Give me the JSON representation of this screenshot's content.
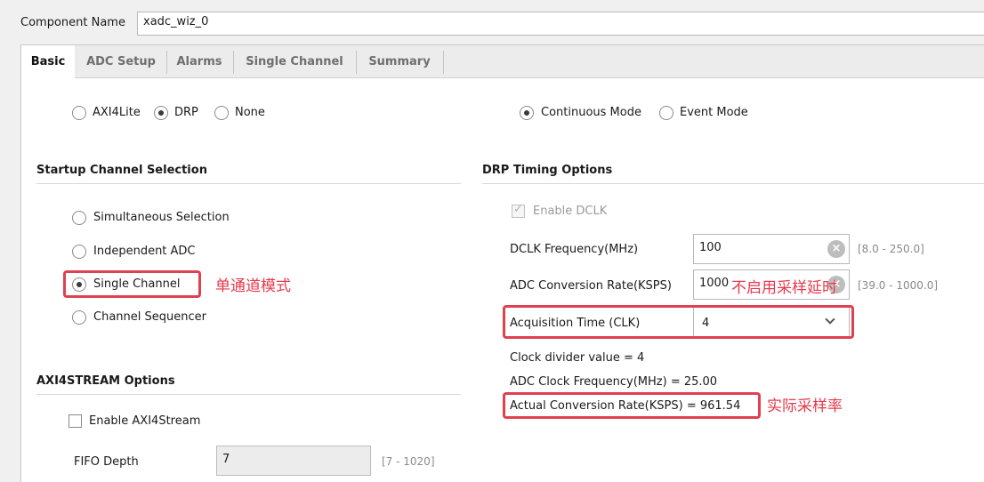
{
  "component": {
    "label": "Component Name",
    "value": "xadc_wiz_0"
  },
  "tabs": [
    {
      "label": "Basic",
      "active": true
    },
    {
      "label": "ADC Setup",
      "active": false
    },
    {
      "label": "Alarms",
      "active": false
    },
    {
      "label": "Single Channel",
      "active": false
    },
    {
      "label": "Summary",
      "active": false
    }
  ],
  "interface": {
    "options": [
      {
        "label": "AXI4Lite",
        "selected": false
      },
      {
        "label": "DRP",
        "selected": true
      },
      {
        "label": "None",
        "selected": false
      }
    ]
  },
  "mode": {
    "options": [
      {
        "label": "Continuous Mode",
        "selected": true
      },
      {
        "label": "Event Mode",
        "selected": false
      }
    ]
  },
  "startup": {
    "title": "Startup Channel Selection",
    "options": [
      {
        "label": "Simultaneous Selection",
        "selected": false
      },
      {
        "label": "Independent ADC",
        "selected": false
      },
      {
        "label": "Single Channel",
        "selected": true
      },
      {
        "label": "Channel Sequencer",
        "selected": false
      }
    ]
  },
  "drp": {
    "title": "DRP Timing Options",
    "enable_dclk": "Enable DCLK",
    "dclk_label": "DCLK Frequency(MHz)",
    "dclk_value": "100",
    "dclk_range": "[8.0 - 250.0]",
    "adc_rate_label": "ADC Conversion Rate(KSPS)",
    "adc_rate_value": "1000",
    "adc_rate_range": "[39.0 - 1000.0]",
    "acq_label": "Acquisition Time (CLK)",
    "acq_value": "4",
    "clock_divider": "Clock divider value = 4",
    "adc_clock": "ADC Clock Frequency(MHz) = 25.00",
    "actual_rate": "Actual Conversion Rate(KSPS) = 961.54"
  },
  "axi4stream": {
    "title": "AXI4STREAM Options",
    "enable": "Enable AXI4Stream",
    "fifo_label": "FIFO Depth",
    "fifo_value": "7",
    "fifo_range": "[7 - 1020]"
  },
  "annotations": {
    "single_channel": "单通道模式",
    "no_acq_delay": "不启用采样延时",
    "actual_rate": "实际采样率"
  },
  "colors": {
    "annotation": "#e63a4c",
    "panel": "#ffffff",
    "background": "#f0f0f0"
  }
}
